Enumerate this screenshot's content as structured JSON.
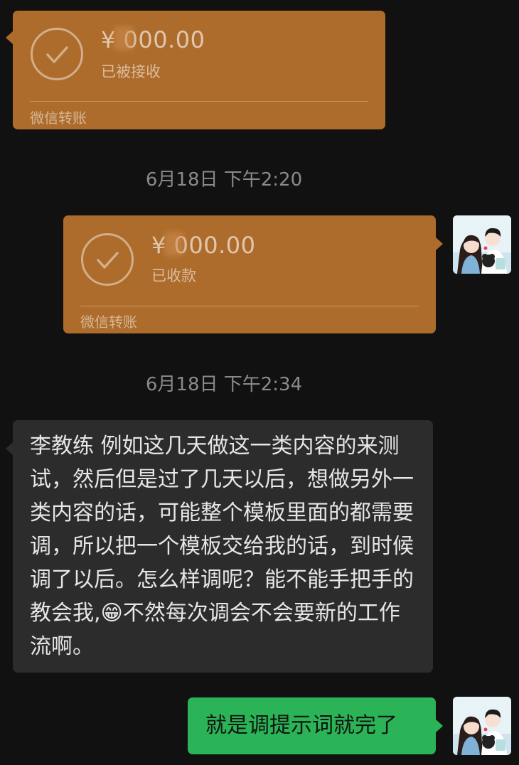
{
  "messages": {
    "transfer_received": {
      "amount": "¥ 000.00",
      "status": "已被接收",
      "label": "微信转账"
    },
    "timestamp_1": "6月18日 下午2:20",
    "transfer_collected": {
      "amount": "¥ 000.00",
      "status": "已收款",
      "label": "微信转账"
    },
    "timestamp_2": "6月18日 下午2:34",
    "incoming_text": "李教练 例如这几天做这一类内容的来测试，然后但是过了几天以后，想做另外一类内容的话，可能整个模板里面的都需要调，所以把一个模板交给我的话，到时候调了以后。怎么样调呢？能不能手把手的教会我,",
    "incoming_emoji": "😁",
    "incoming_text_end": "不然每次调会不会要新的工作流啊。",
    "outgoing_text": "就是调提示词就完了"
  },
  "colors": {
    "background": "#111111",
    "transfer_card": "#ad6c2b",
    "incoming_bubble": "#2c2c2c",
    "outgoing_bubble": "#2bb457",
    "timestamp_text": "#8a8a8a"
  },
  "icons": {
    "transfer_status": "check-circle-icon",
    "avatar": "couple-cartoon-avatar"
  }
}
